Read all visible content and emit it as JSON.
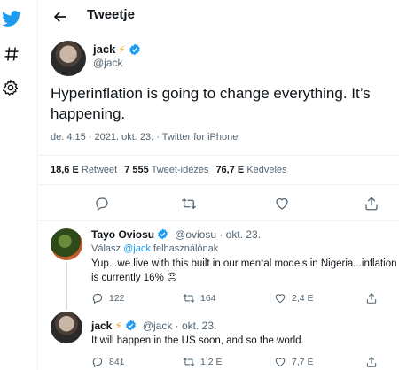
{
  "colors": {
    "accent": "#1d9bf0",
    "text": "#0f1419",
    "muted": "#536471",
    "bolt": "#f5a623"
  },
  "nav": {
    "icons": [
      "twitter-bird-icon",
      "hashtag-icon",
      "settings-gear-icon"
    ]
  },
  "header": {
    "title": "Tweetje"
  },
  "tweet": {
    "author_name": "jack",
    "author_handle": "@jack",
    "bolt": "⚡",
    "text": "Hyperinflation is going to change everything. It’s happening.",
    "meta": "de. 4:15 · 2021. okt. 23. · Twitter for iPhone",
    "stats": {
      "retweets_count": "18,6 E",
      "retweets_label": "Retweet",
      "quotes_count": "7 555",
      "quotes_label": "Tweet-idézés",
      "likes_count": "76,7 E",
      "likes_label": "Kedvelés"
    }
  },
  "replies": [
    {
      "author_name": "Tayo Oviosu",
      "author_meta": "@oviosu · okt. 23.",
      "replying_prefix": "Válasz",
      "replying_mention": "@jack",
      "replying_suffix": "felhasználónak",
      "text": "Yup...we live with this built in our mental models in Nigeria...inflation is currently 16% 😐",
      "reply_count": "122",
      "retweet_count": "164",
      "like_count": "2,4 E"
    },
    {
      "author_name": "jack",
      "bolt": "⚡",
      "author_meta": "@jack · okt. 23.",
      "text": "It will happen in the US soon, and so the world.",
      "reply_count": "841",
      "retweet_count": "1,2 E",
      "like_count": "7,7 E"
    }
  ]
}
